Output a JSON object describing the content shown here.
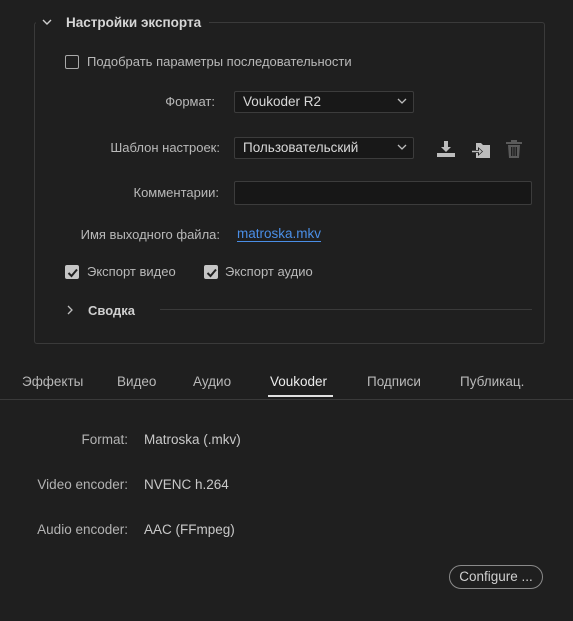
{
  "export_settings": {
    "title": "Настройки экспорта",
    "match_sequence_label": "Подобрать параметры последовательности",
    "match_sequence_checked": false,
    "format_label": "Формат:",
    "format_value": "Voukoder R2",
    "preset_label": "Шаблон настроек:",
    "preset_value": "Пользовательский",
    "comments_label": "Комментарии:",
    "comments_value": "",
    "output_name_label": "Имя выходного файла:",
    "output_name_value": "matroska.mkv",
    "export_video_label": "Экспорт видео",
    "export_video_checked": true,
    "export_audio_label": "Экспорт аудио",
    "export_audio_checked": true,
    "summary_label": "Сводка",
    "icons": [
      "save-preset-icon",
      "import-preset-icon",
      "delete-preset-icon"
    ]
  },
  "tabs": [
    {
      "label": "Эффекты",
      "active": false
    },
    {
      "label": "Видео",
      "active": false
    },
    {
      "label": "Аудио",
      "active": false
    },
    {
      "label": "Voukoder",
      "active": true
    },
    {
      "label": "Подписи",
      "active": false
    },
    {
      "label": "Публикац.",
      "active": false
    }
  ],
  "voukoder": {
    "format_label": "Format:",
    "format_value": "Matroska (.mkv)",
    "video_encoder_label": "Video encoder:",
    "video_encoder_value": "NVENC h.264",
    "audio_encoder_label": "Audio encoder:",
    "audio_encoder_value": "AAC (FFmpeg)",
    "configure_label": "Configure ..."
  },
  "colors": {
    "background": "#1f1f1f",
    "link": "#4a8ee6",
    "border": "#3a3a3a"
  }
}
